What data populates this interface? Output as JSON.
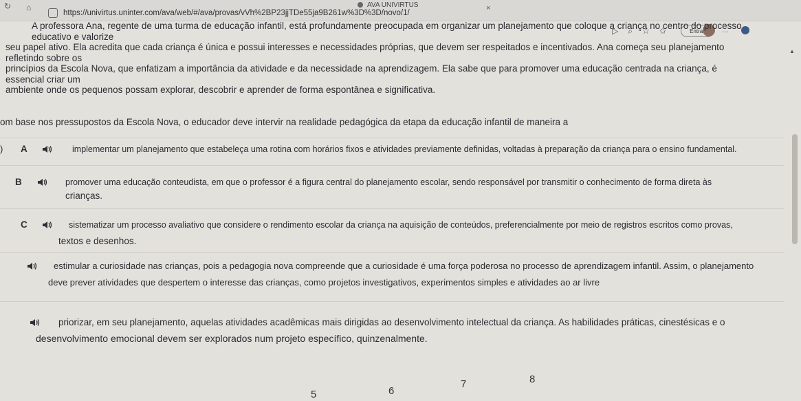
{
  "browser": {
    "tab_title": "AVA UNIVIRTUS",
    "url": "https://univirtus.uninter.com/ava/web/#/ava/provas/vVh%2BP23jjTDe55ja9B261w%3D%3D/novo/1/",
    "signin_label": "Entrar",
    "menu_label": "..."
  },
  "context": {
    "line1": "A professora Ana, regente de uma turma de educação infantil, está profundamente preocupada em organizar um planejamento que coloque a criança no centro do processo educativo e valorize",
    "line2": "seu papel ativo. Ela acredita que cada criança é única e possui interesses e necessidades próprias, que devem ser respeitados e incentivados. Ana começa seu planejamento refletindo sobre os",
    "line3": "princípios da Escola Nova, que enfatizam a importância da atividade e da necessidade na aprendizagem. Ela sabe que para promover uma educação centrada na criança, é essencial criar um",
    "line4": "ambiente onde os pequenos possam explorar, descobrir e aprender de forma espontânea e significativa."
  },
  "question": "om base nos pressupostos da Escola Nova, o educador deve intervir na realidade pedagógica da etapa da educação infantil de maneira a",
  "options": {
    "a": {
      "letter": "A",
      "line1": "implementar um planejamento que estabeleça uma rotina com horários fixos e atividades previamente definidas, voltadas à preparação da criança para o ensino fundamental.",
      "line2": ""
    },
    "b": {
      "letter": "B",
      "line1": "promover uma educação conteudista, em que o professor é a figura central do planejamento escolar, sendo responsável por transmitir o conhecimento de forma direta às",
      "line2": "crianças."
    },
    "c": {
      "letter": "C",
      "line1": "sistematizar um processo avaliativo que considere o rendimento escolar da criança na aquisição de conteúdos, preferencialmente por meio de registros escritos como provas,",
      "line2": "textos e desenhos."
    },
    "d": {
      "letter": "",
      "line1": "estimular a curiosidade nas crianças, pois a pedagogia nova compreende que a curiosidade é uma força poderosa no processo de aprendizagem infantil. Assim, o planejamento",
      "line2": "deve prever atividades que despertem o interesse das crianças, como projetos investigativos, experimentos simples e atividades ao ar livre"
    },
    "e": {
      "letter": "",
      "line1": "priorizar, em seu planejamento, aquelas atividades acadêmicas mais dirigidas ao desenvolvimento intelectual da criança. As habilidades práticas, cinestésicas e o",
      "line2": "desenvolvimento emocional devem ser explorados num projeto específico, quinzenalmente."
    }
  },
  "pagination": [
    "5",
    "6",
    "7",
    "8"
  ],
  "colors": {
    "text": "#2c2c33",
    "background": "#e3e1dc",
    "speaker": "#2f2f35"
  }
}
